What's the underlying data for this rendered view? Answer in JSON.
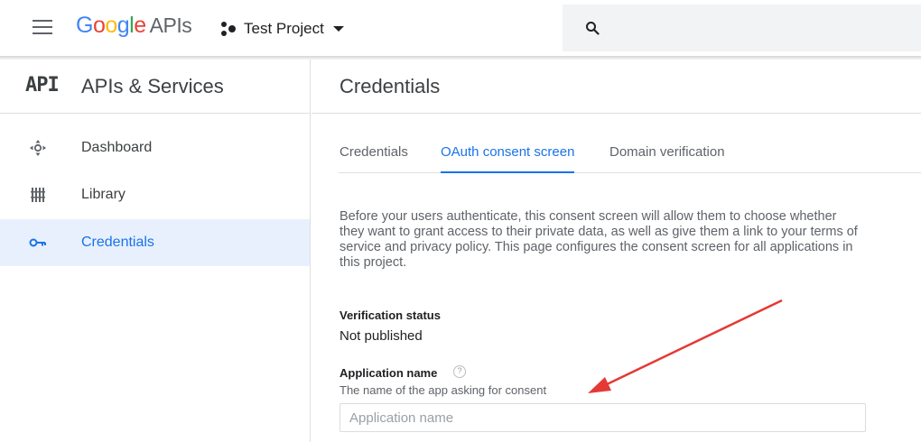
{
  "topbar": {
    "logo_letters": [
      "G",
      "o",
      "o",
      "g",
      "l",
      "e"
    ],
    "logo_suffix": "APIs",
    "project_name": "Test Project"
  },
  "sidenav": {
    "badge": "API",
    "title": "APIs & Services",
    "items": [
      {
        "label": "Dashboard",
        "icon": "dashboard-icon"
      },
      {
        "label": "Library",
        "icon": "library-icon"
      },
      {
        "label": "Credentials",
        "icon": "key-icon",
        "active": true
      }
    ]
  },
  "main": {
    "title": "Credentials",
    "tabs": [
      {
        "label": "Credentials"
      },
      {
        "label": "OAuth consent screen",
        "active": true
      },
      {
        "label": "Domain verification"
      }
    ],
    "description": "Before your users authenticate, this consent screen will allow them to choose whether they want to grant access to their private data, as well as give them a link to your terms of service and privacy policy. This page configures the consent screen for all applications in this project.",
    "verification_label": "Verification status",
    "verification_value": "Not published",
    "app_name_label": "Application name",
    "app_name_hint": "The name of the app asking for consent",
    "app_name_placeholder": "Application name",
    "app_name_value": ""
  },
  "colors": {
    "accent": "#1a73e8",
    "annotation_arrow": "#e53935",
    "active_nav_bg": "#e8f0fe"
  }
}
